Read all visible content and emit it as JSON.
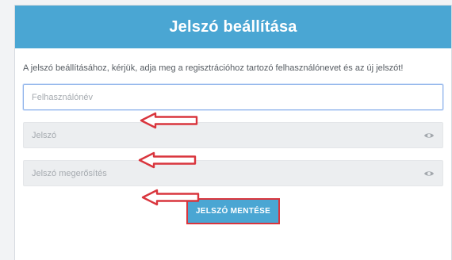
{
  "header": {
    "title": "Jelszó beállítása"
  },
  "instructions": {
    "text": "A jelszó beállításához, kérjük, adja meg a regisztrációhoz tartozó felhasználónevet és az új jelszót!"
  },
  "fields": {
    "username": {
      "placeholder": "Felhasználónév",
      "value": ""
    },
    "password": {
      "placeholder": "Jelszó",
      "value": ""
    },
    "password_confirm": {
      "placeholder": "Jelszó megerősítés",
      "value": ""
    }
  },
  "icons": {
    "arrow": "left-arrow-annotation-icon",
    "eye": "eye-icon"
  },
  "colors": {
    "header": "#4aa6d3",
    "annotation": "#d9353d",
    "button": "#4aa6d3"
  },
  "actions": {
    "save_label": "JELSZÓ MENTÉSE"
  }
}
